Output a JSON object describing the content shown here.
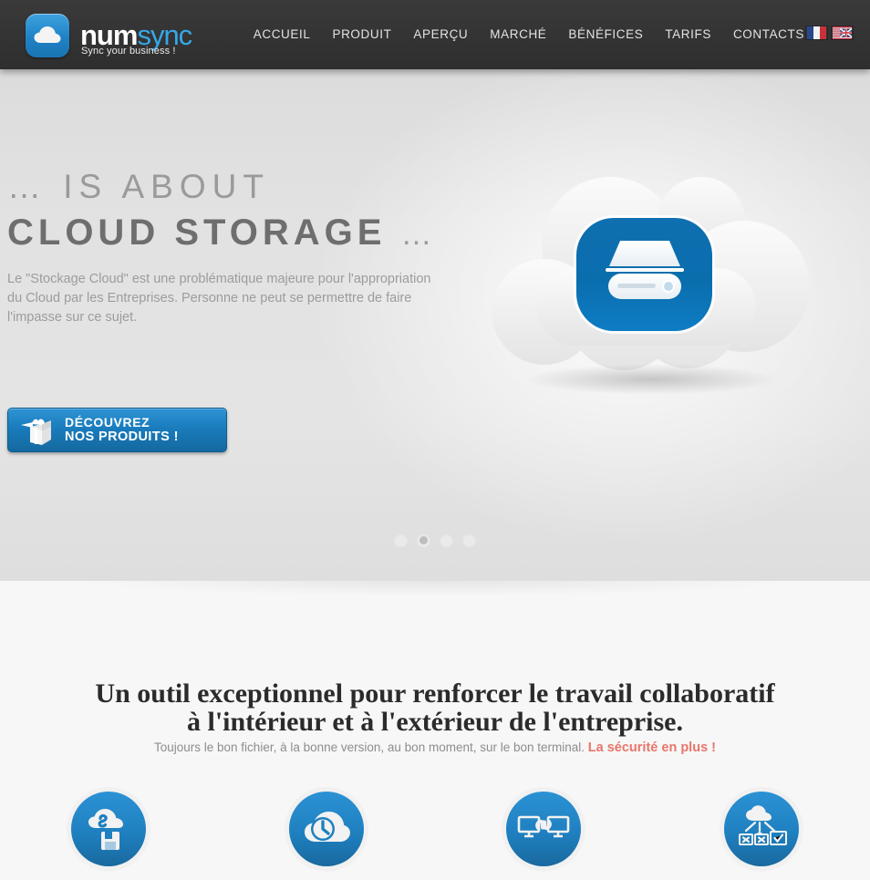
{
  "header": {
    "logo": {
      "mark_icon": "cloud-icon",
      "word_primary": "num",
      "word_secondary": "sync",
      "tagline": "Sync your business !"
    },
    "nav": [
      {
        "label": "ACCUEIL"
      },
      {
        "label": "PRODUIT"
      },
      {
        "label": "APERÇU"
      },
      {
        "label": "MARCHÉ"
      },
      {
        "label": "BÉNÉFICES"
      },
      {
        "label": "TARIFS"
      },
      {
        "label": "CONTACTS"
      }
    ],
    "languages": [
      {
        "name": "french-flag",
        "label": "FR"
      },
      {
        "name": "english-flag",
        "label": "EN"
      }
    ],
    "bg_color": "#343434",
    "nav_text_color": "#e3e3e3"
  },
  "hero": {
    "line1": "… IS ABOUT",
    "line2": "CLOUD STORAGE",
    "line2_tail": "…",
    "paragraph": "Le \"Stockage Cloud\" est une problématique majeure pour l'appropriation du Cloud par les Entreprises. Personne ne peut se permettre de faire l'impasse sur ce sujet.",
    "cta": {
      "icon": "gift-box-icon",
      "line1": "DÉCOUVREZ",
      "line2": "NOS PRODUITS !",
      "color": "#1a7cbd"
    },
    "illustration": {
      "name": "cloud-storage-illustration",
      "cloud_color": "#f0f0f0",
      "badge_color": "#0a6ead",
      "badge_icon": "hard-drive-icon"
    },
    "slider": {
      "total_dots": 4,
      "active_index": 1
    }
  },
  "section2": {
    "title_line1": "Un outil exceptionnel pour renforcer le travail collaboratif",
    "title_line2": "à l'intérieur et à l'extérieur de l'entreprise.",
    "subtitle_plain": "Toujours le bon fichier, à la bonne version, au bon moment, sur le bon terminal. ",
    "subtitle_highlight": "La sécurité en plus !",
    "highlight_color": "#e8766b",
    "features": [
      {
        "icon": "cloud-sync-save-icon"
      },
      {
        "icon": "cloud-clock-icon"
      },
      {
        "icon": "linked-monitors-icon"
      },
      {
        "icon": "cloud-multi-device-icon"
      }
    ]
  }
}
